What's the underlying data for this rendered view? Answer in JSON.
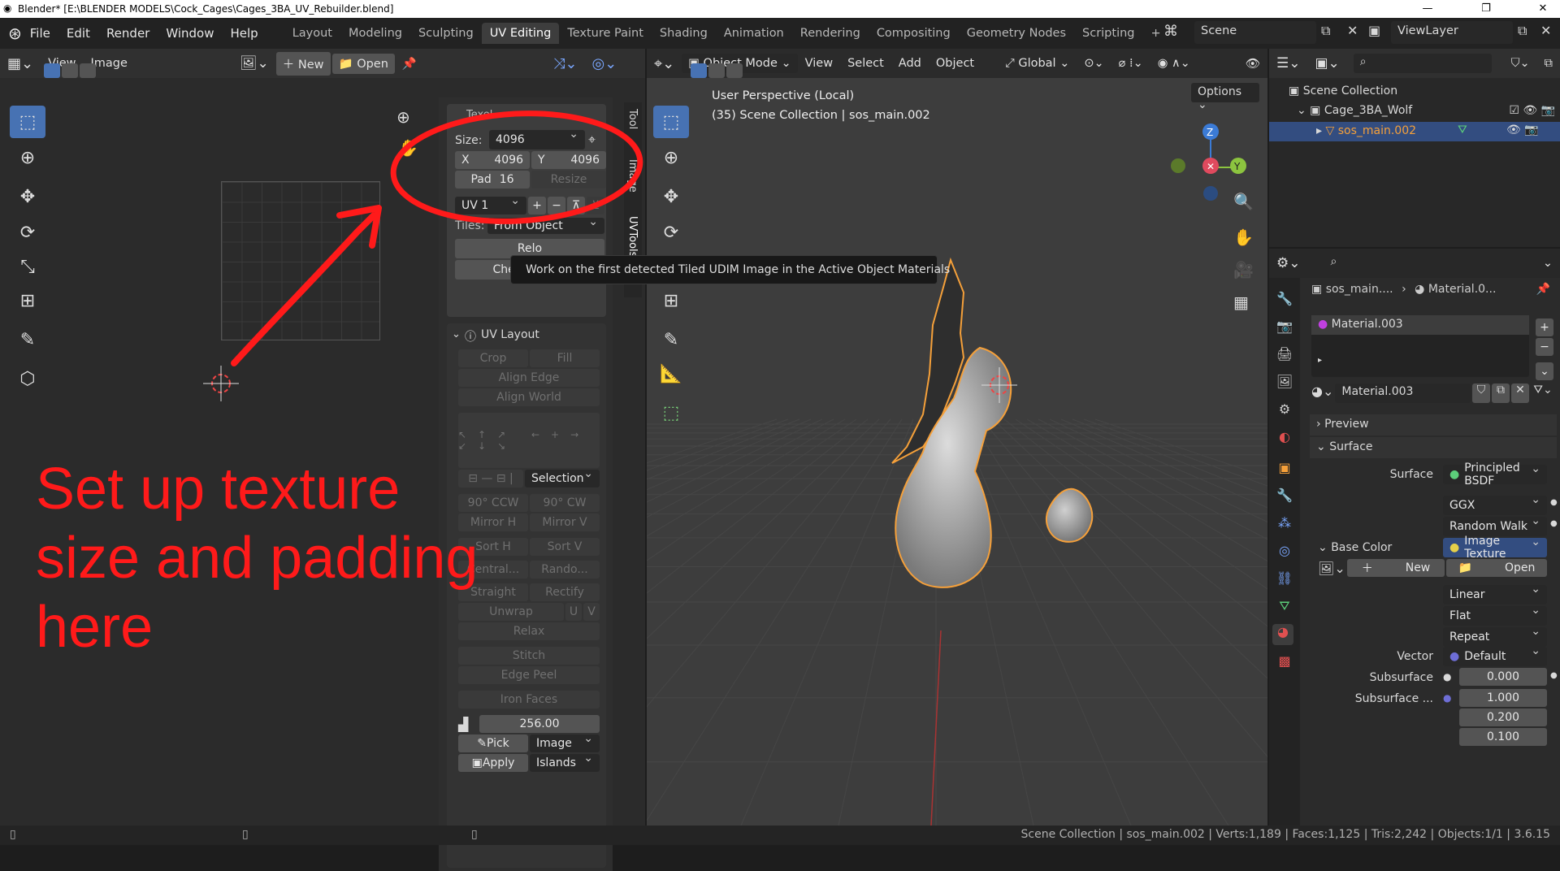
{
  "window": {
    "title": "Blender* [E:\\BLENDER MODELS\\Cock_Cages\\Cages_3BA_UV_Rebuilder.blend]",
    "min": "—",
    "max": "❐",
    "close": "✕"
  },
  "menu": [
    "File",
    "Edit",
    "Render",
    "Window",
    "Help"
  ],
  "workspaces": [
    "Layout",
    "Modeling",
    "Sculpting",
    "UV Editing",
    "Texture Paint",
    "Shading",
    "Animation",
    "Rendering",
    "Compositing",
    "Geometry Nodes",
    "Scripting"
  ],
  "scene": {
    "name": "Scene",
    "view_layer": "ViewLayer"
  },
  "uv_editor": {
    "view": "View",
    "image": "Image",
    "new": "New",
    "open": "Open"
  },
  "texel_panel": {
    "tab_title": "Texel",
    "size_label": "Size:",
    "size_value": "4096",
    "x_label": "X",
    "x_value": "4096",
    "y_label": "Y",
    "y_value": "4096",
    "pad_label": "Pad",
    "pad_value": "16",
    "resize": "Resize",
    "uv_channel": "UV 1",
    "tiles_label": "Tiles:",
    "tiles_value": "From Object",
    "reload": "Relo",
    "checker_map": "Checker Map"
  },
  "vtabs": [
    "Tool",
    "Image",
    "UVTools"
  ],
  "tooltip": "Work on the first detected Tiled UDIM Image in the Active Object Materials",
  "uv_layout": {
    "title": "UV Layout",
    "crop": "Crop",
    "fill": "Fill",
    "align_edge": "Align Edge",
    "align_world": "Align World",
    "selection": "Selection",
    "ccw": "90° CCW",
    "cw": "90° CW",
    "mirror_h": "Mirror H",
    "mirror_v": "Mirror V",
    "sort_h": "Sort H",
    "sort_v": "Sort V",
    "central": "Central...",
    "random": "Rando...",
    "straight": "Straight",
    "rectify": "Rectify",
    "unwrap": "Unwrap",
    "u": "U",
    "v": "V",
    "relax": "Relax",
    "stitch": "Stitch",
    "edge_peel": "Edge Peel",
    "iron_faces": "Iron Faces",
    "texel_value": "256.00",
    "pick": "Pick",
    "pick_mode": "Image",
    "apply": "Apply",
    "apply_mode": "Islands"
  },
  "viewport": {
    "mode": "Object Mode",
    "view": "View",
    "select": "Select",
    "add": "Add",
    "object": "Object",
    "orientation": "Global",
    "options": "Options",
    "info_line1": "User Perspective (Local)",
    "info_line2": "(35) Scene Collection | sos_main.002",
    "gizmo_z": "Z",
    "gizmo_y": "Y"
  },
  "outliner": {
    "scene_collection": "Scene Collection",
    "collection": "Cage_3BA_Wolf",
    "object": "sos_main.002"
  },
  "properties": {
    "breadcrumb_obj": "sos_main....",
    "breadcrumb_mat": "Material.0...",
    "slot": "Material.003",
    "material": "Material.003",
    "preview": "Preview",
    "surface_section": "Surface",
    "surface_label": "Surface",
    "surface_value": "Principled BSDF",
    "dist": "GGX",
    "sss_method": "Random Walk",
    "base_color": "Base Color",
    "base_color_value": "Image Texture",
    "new": "New",
    "open": "Open",
    "interp": "Linear",
    "proj": "Flat",
    "ext": "Repeat",
    "vector_label": "Vector",
    "vector_value": "Default",
    "subsurface_label": "Subsurface",
    "subsurface_value": "0.000",
    "subsurface_radius_label": "Subsurface ...",
    "r1": "1.000",
    "r2": "0.200",
    "r3": "0.100"
  },
  "status": "Scene Collection | sos_main.002 | Verts:1,189 | Faces:1,125 | Tris:2,242 | Objects:1/1 | 3.6.15",
  "annotation": {
    "line1": "Set up texture",
    "line2": "size and padding",
    "line3": "here"
  },
  "colors": {
    "accent": "#4772b3",
    "annotation": "#ff1a1a",
    "selection_outline": "#f5a03a",
    "bg": "#303030"
  }
}
